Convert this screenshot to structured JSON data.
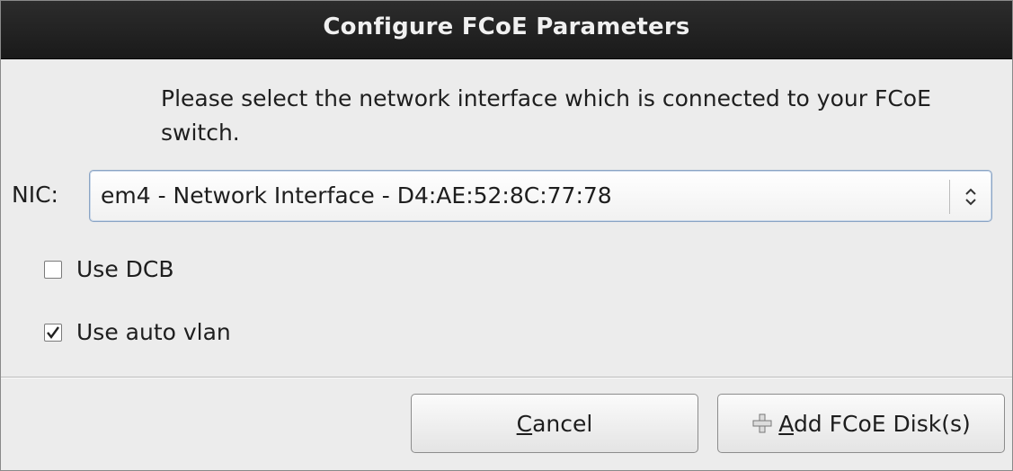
{
  "dialog": {
    "title": "Configure FCoE Parameters",
    "prompt": "Please select the network interface which is connected to your FCoE switch."
  },
  "nic": {
    "label": "NIC:",
    "selected": "em4 - Network Interface - D4:AE:52:8C:77:78"
  },
  "options": {
    "use_dcb": {
      "label": "Use DCB",
      "checked": false
    },
    "use_auto_vlan": {
      "label": "Use auto vlan",
      "checked": true
    }
  },
  "buttons": {
    "cancel": {
      "mnemonic": "C",
      "rest": "ancel"
    },
    "add": {
      "mnemonic": "A",
      "rest": "dd FCoE Disk(s)",
      "icon": "plus-icon"
    }
  },
  "colors": {
    "titlebar": "#1a1a1a",
    "title_text": "#f0f0f0",
    "focus_border": "#8aa4c4"
  }
}
